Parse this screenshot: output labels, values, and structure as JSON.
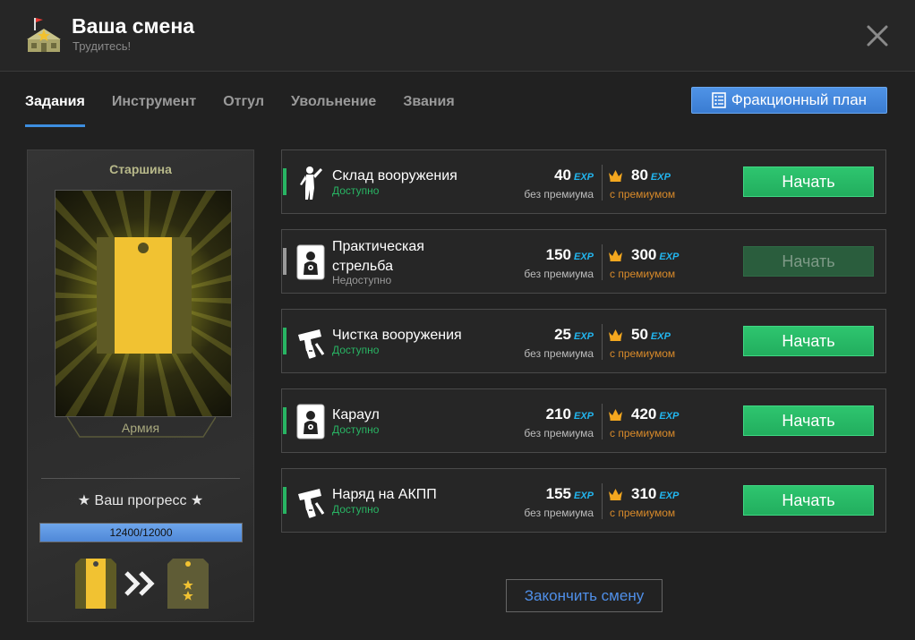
{
  "header": {
    "title": "Ваша смена",
    "subtitle": "Трудитесь!",
    "icon": "barracks-icon",
    "close_icon": "close-icon"
  },
  "tabs": [
    {
      "label": "Задания",
      "active": true
    },
    {
      "label": "Инструмент",
      "active": false
    },
    {
      "label": "Отгул",
      "active": false
    },
    {
      "label": "Увольнение",
      "active": false
    },
    {
      "label": "Звания",
      "active": false
    }
  ],
  "plan_button": {
    "label": "Фракционный план",
    "icon": "checklist-icon"
  },
  "rank": {
    "name": "Старшина",
    "branch": "Армия",
    "progress_title": "★ Ваш прогресс ★",
    "progress_text": "12400/12000",
    "progress_fraction": 1.0,
    "current_icon": "rank-strap-yellow-icon",
    "next_icon": "rank-strap-two-stars-icon",
    "arrow_icon": "double-chevron-right-icon"
  },
  "labels": {
    "exp": "EXP",
    "base": "без премиума",
    "premium": "с премиумом"
  },
  "tasks": [
    {
      "name": "Склад вооружения",
      "status": "Доступно",
      "exp_base": "40",
      "exp_premium": "80",
      "button": "Начать",
      "available": true,
      "icon": "soldier-salute-icon"
    },
    {
      "name": "Практическая стрельба",
      "status": "Недоступно",
      "exp_base": "150",
      "exp_premium": "300",
      "button": "Начать",
      "available": false,
      "icon": "shooting-target-icon"
    },
    {
      "name": "Чистка вооружения",
      "status": "Доступно",
      "exp_base": "25",
      "exp_premium": "50",
      "button": "Начать",
      "available": true,
      "icon": "pistol-cleaning-icon"
    },
    {
      "name": "Караул",
      "status": "Доступно",
      "exp_base": "210",
      "exp_premium": "420",
      "button": "Начать",
      "available": true,
      "icon": "shooting-target-icon"
    },
    {
      "name": "Наряд на АКПП",
      "status": "Доступно",
      "exp_base": "155",
      "exp_premium": "310",
      "button": "Начать",
      "available": true,
      "icon": "pistol-cleaning-icon"
    }
  ],
  "finish_button": "Закончить смену",
  "colors": {
    "accent_blue": "#3d8ee0",
    "start_green": "#28b463",
    "exp_cyan": "#22b6f0",
    "premium_orange": "#d88a2a"
  }
}
